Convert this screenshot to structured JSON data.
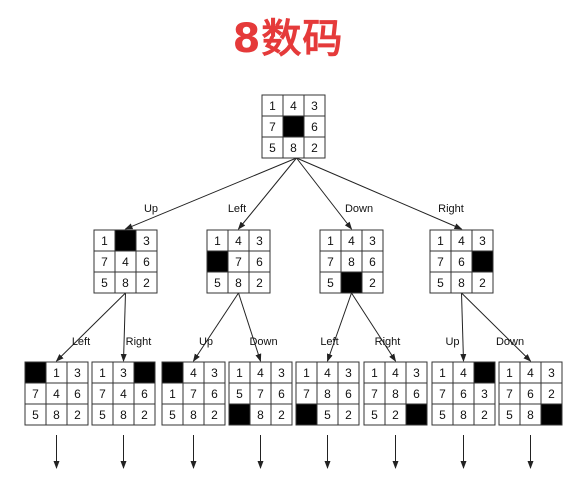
{
  "title": "8数码",
  "blank_color": "#000000",
  "title_color": "#e53a3a",
  "tree": {
    "board": [
      "1",
      "4",
      "3",
      "7",
      "",
      "6",
      "5",
      "8",
      "2"
    ],
    "children": [
      {
        "move": "Up",
        "board": [
          "1",
          "",
          "3",
          "7",
          "4",
          "6",
          "5",
          "8",
          "2"
        ],
        "children": [
          {
            "move": "Left",
            "board": [
              "",
              "1",
              "3",
              "7",
              "4",
              "6",
              "5",
              "8",
              "2"
            ]
          },
          {
            "move": "Right",
            "board": [
              "1",
              "3",
              "",
              "7",
              "4",
              "6",
              "5",
              "8",
              "2"
            ]
          }
        ]
      },
      {
        "move": "Left",
        "board": [
          "1",
          "4",
          "3",
          "",
          "7",
          "6",
          "5",
          "8",
          "2"
        ],
        "children": [
          {
            "move": "Up",
            "board": [
              "",
              "4",
              "3",
              "1",
              "7",
              "6",
              "5",
              "8",
              "2"
            ]
          },
          {
            "move": "Down",
            "board": [
              "1",
              "4",
              "3",
              "5",
              "7",
              "6",
              "",
              "8",
              "2"
            ]
          }
        ]
      },
      {
        "move": "Down",
        "board": [
          "1",
          "4",
          "3",
          "7",
          "8",
          "6",
          "5",
          "",
          "2"
        ],
        "children": [
          {
            "move": "Left",
            "board": [
              "1",
              "4",
              "3",
              "7",
              "8",
              "6",
              "",
              "5",
              "2"
            ]
          },
          {
            "move": "Right",
            "board": [
              "1",
              "4",
              "3",
              "7",
              "8",
              "6",
              "5",
              "2",
              ""
            ]
          }
        ]
      },
      {
        "move": "Right",
        "board": [
          "1",
          "4",
          "3",
          "7",
          "6",
          "",
          "5",
          "8",
          "2"
        ],
        "children": [
          {
            "move": "Up",
            "board": [
              "1",
              "4",
              "",
              "7",
              "6",
              "3",
              "5",
              "8",
              "2"
            ]
          },
          {
            "move": "Down",
            "board": [
              "1",
              "4",
              "3",
              "7",
              "6",
              "2",
              "5",
              "8",
              ""
            ]
          }
        ]
      }
    ]
  }
}
